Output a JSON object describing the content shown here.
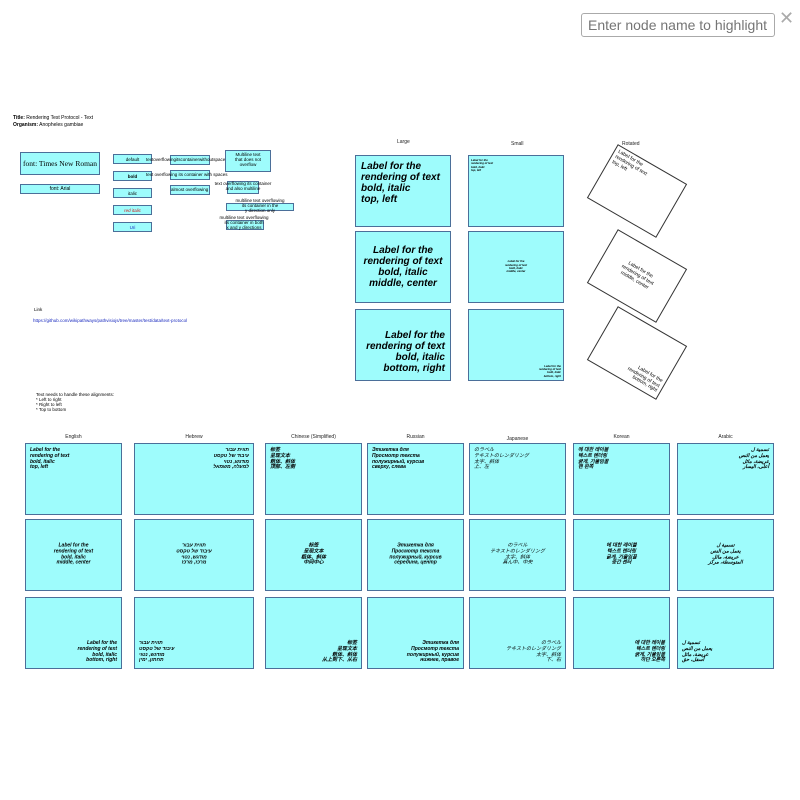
{
  "search": {
    "placeholder": "Enter node name to highlight"
  },
  "close_icon_glyph": "✕",
  "info": {
    "title_label": "Title:",
    "title_value": "Rendering Test Protocol - Text",
    "organism_label": "Organism:",
    "organism_value": "Anopheles gambiae"
  },
  "fonts": {
    "times": "font: Times New Roman",
    "arial": "font: Arial"
  },
  "styles": {
    "default": "default",
    "bold": "bold",
    "italic": "italic",
    "red_italic": "red italic",
    "uri": "Uri"
  },
  "overflow": {
    "horizontal": "textoverflowingitscontainerwithoutspaces",
    "with_spaces": "text overflowing its container with spaces",
    "almost": "almost overflowing",
    "multiline_fit": "Multiline text\nthat does not\noverflow",
    "overflow_multiline": "text overflowing its container\nand also multiline",
    "multiline_one_dir": "multiline text overflowing\nits container in the\ny direction only",
    "multiline_both": "multiline text overflowing\nits container in both\nx and y directions"
  },
  "link": {
    "label": "Link",
    "url": "https://github.com/wikipathways/pathvisiojs/tree/master/test/data/text-protocol"
  },
  "alignment_note": "Text needs to handle these alignments:\n* Left to right\n* Right to left\n* Top to bottom",
  "headers": {
    "large": "Large",
    "small": "Small",
    "rotated": "Rotated"
  },
  "large_labels": {
    "top_left": "Label for the\nrendering of text\nbold, italic\ntop, left",
    "middle_center": "Label for the\nrendering of text\nbold, italic\nmiddle, center",
    "bottom_right": "Label for the\nrendering of text\nbold, italic\nbottom, right"
  },
  "small_labels": {
    "top_left": "Label for the\nrendering of text\nbold, italic\ntop, left",
    "middle_center": "Label for the\nrendering of text\nbold, italic\nmiddle, center",
    "bottom_right": "Label for the\nrendering of text\nbold, italic\nbottom, right"
  },
  "rotated_labels": {
    "top_left": "Label for the\nrendering of text\ntop, left",
    "middle_center": "Label for the\nrendering of text\nmiddle, center",
    "bottom_right": "Label for the\nrendering of text\nbottom, right"
  },
  "languages": [
    {
      "name": "English",
      "top": "Label for the\nrendering of text\nbold, italic\ntop, left",
      "mid": "Label for the\nrendering of text\nbold, italic\nmiddle, center",
      "bot": "Label for the\nrendering of text\nbold, italic\nbottom, right"
    },
    {
      "name": "Hebrew",
      "top": "תווית עבור\nעיבוד של טקסט\nמודגש, נטוי\nלמעלה, משמאל",
      "mid": "תווית עבור\nעיבוד של טקסט\nמודגש, נטוי\nמרכז, מרכז",
      "bot": "תווית עבור\nעיבוד של טקסט\nמודגש, נטוי\nתחתון, ימין"
    },
    {
      "name": "Chinese (Simplified)",
      "top": "标签\n呈现文本\n粗体、斜体\n顶部、左侧",
      "mid": "标签\n呈现文本\n粗体、斜体\n中间中心",
      "bot": "标签\n呈现文本\n粗体、斜体\n从上到下、从右"
    },
    {
      "name": "Russian",
      "top": "Этикетка для\nПросмотр текста\nполужирный, курсив\nсверху, слева",
      "mid": "Этикетка для\nПросмотр текста\nполужирный, курсив\nсередина, центр",
      "bot": "Этикетка для\nПросмотр текста\nполужирный, курсив\nнижнее, правое"
    },
    {
      "name": "Japanese",
      "top": "のラベル\nテキストのレンダリング\n太字、斜体\n上、左",
      "mid": "のラベル\nテキストのレンダリング\n太字、斜体\n真ん中、中央",
      "bot": "のラベル\nテキストのレンダリング\n太字、斜体\n下、右"
    },
    {
      "name": "Korean",
      "top": "에 대한 레이블\n텍스트 렌더링\n굵게, 기울임꼴\n맨 왼쪽",
      "mid": "에 대한 레이블\n텍스트 렌더링\n굵게, 기울임꼴\n중간 센터",
      "bot": "에 대한 레이블\n텍스트 렌더링\n굵게, 기울임꼴\n하단 오른쪽"
    },
    {
      "name": "Arabic",
      "top": "تسمية ل\nيعمل من النص\nعريضة، مائل\nأعلى، اليسار",
      "mid": "تسمية ل\nيعمل من النص\nعريضة، مائل\nالمتوسطة، مركز",
      "bot": "تسمية ل\nيعمل من النص\nعريضة، مائل\nأسفل، حق"
    }
  ]
}
